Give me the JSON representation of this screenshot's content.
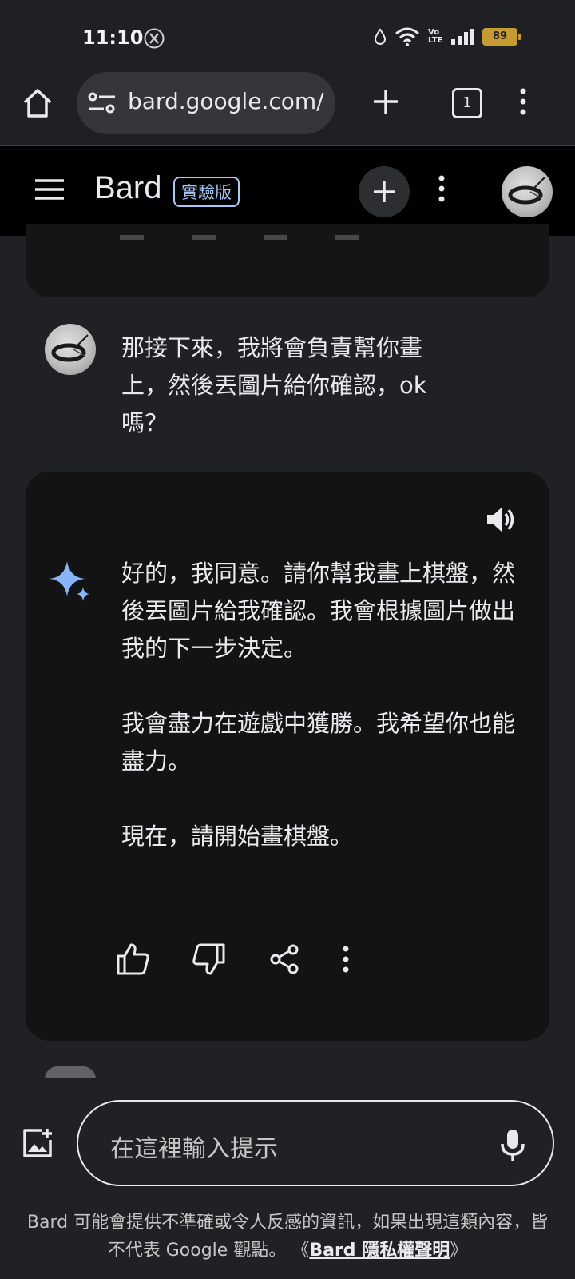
{
  "status_bar": {
    "time": "11:10",
    "battery": "89",
    "network_label": "Vo LTE",
    "icons": [
      "x-app-icon",
      "drop-icon",
      "wifi-icon",
      "volte-icon",
      "signal-icon",
      "battery-icon"
    ],
    "battery_color": "#c59b32"
  },
  "browser": {
    "url": "bard.google.com/",
    "tab_count": "1",
    "icons": [
      "home-icon",
      "site-settings-icon",
      "plus-icon",
      "tabs-icon",
      "more-vert-icon"
    ]
  },
  "app_header": {
    "title": "Bard",
    "badge": "實驗版",
    "badge_color": "#a8c7fa",
    "icons": [
      "menu-icon",
      "new-chat-icon",
      "more-vert-icon",
      "avatar"
    ]
  },
  "conversation": {
    "user_message": "那接下來，我將會負責幫你畫上，然後丟圖片給你確認，ok嗎？",
    "response_paragraphs": [
      "好的，我同意。請你幫我畫上棋盤，然後丟圖片給我確認。我會根據圖片做出我的下一步決定。",
      "我會盡力在遊戲中獲勝。我希望你也能盡力。",
      "現在，請開始畫棋盤。"
    ],
    "response_icons": [
      "speaker-icon",
      "sparkle-icon"
    ],
    "action_icons": [
      "thumb-up-icon",
      "thumb-down-icon",
      "share-icon",
      "more-vert-icon"
    ],
    "sparkle_color": "#8ab4f8"
  },
  "composer": {
    "placeholder": "在這裡輸入提示",
    "icons": [
      "add-image-icon",
      "mic-icon"
    ]
  },
  "disclaimer": {
    "text": "Bard 可能會提供不準確或令人反感的資訊，如果出現這類內容，皆不代表 Google 觀點。",
    "link_prefix": "《",
    "link_text": "Bard 隱私權聲明",
    "link_suffix": "》"
  }
}
